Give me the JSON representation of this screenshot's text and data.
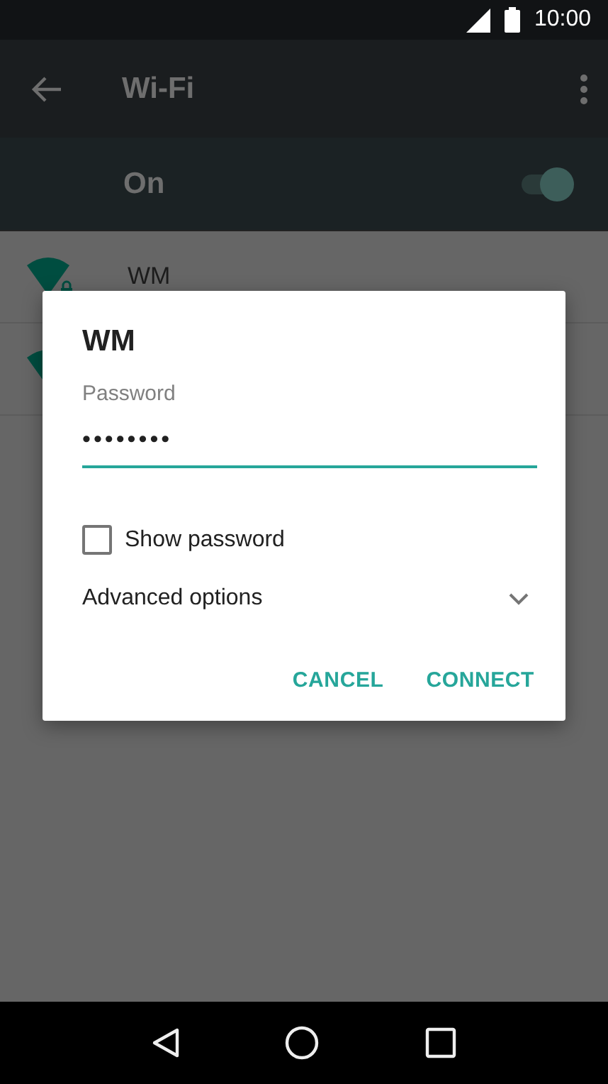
{
  "status_bar": {
    "time": "10:00"
  },
  "app_bar": {
    "title": "Wi-Fi"
  },
  "wifi_switch": {
    "label": "On",
    "on": true
  },
  "networks": [
    {
      "kind": "network",
      "name": "WM",
      "secured": true
    },
    {
      "kind": "network"
    }
  ],
  "dialog": {
    "title": "WM",
    "password_label": "Password",
    "password_value": "••••••••",
    "show_password": {
      "label": "Show password",
      "checked": false
    },
    "advanced": {
      "label": "Advanced options",
      "expanded": false
    },
    "buttons": [
      "CANCEL",
      "CONNECT"
    ]
  }
}
